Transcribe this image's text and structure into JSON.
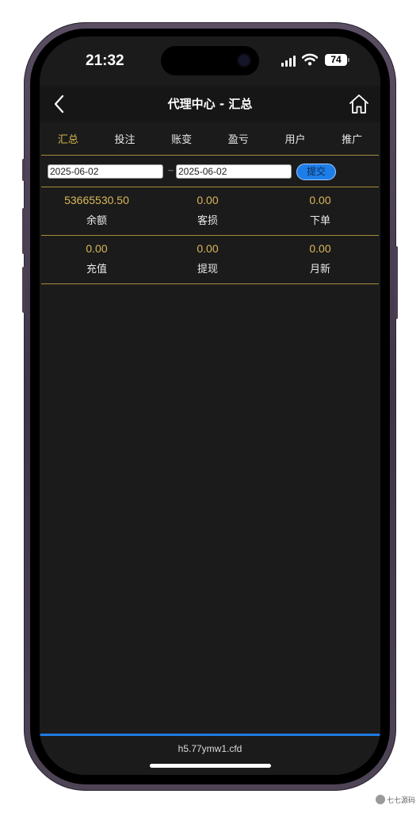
{
  "status_bar": {
    "time": "21:32",
    "battery": "74"
  },
  "header": {
    "title": "代理中心 - 汇总",
    "back_icon": "chevron-left-icon",
    "home_icon": "home-icon"
  },
  "tabs": [
    {
      "label": "汇总",
      "active": true
    },
    {
      "label": "投注",
      "active": false
    },
    {
      "label": "账变",
      "active": false
    },
    {
      "label": "盈亏",
      "active": false
    },
    {
      "label": "用户",
      "active": false
    },
    {
      "label": "推广",
      "active": false
    }
  ],
  "filter": {
    "start_date": "2025-06-02",
    "separator": "~",
    "end_date": "2025-06-02",
    "submit_label": "提交"
  },
  "stats": [
    [
      {
        "value": "53665530.50",
        "label": "余额"
      },
      {
        "value": "0.00",
        "label": "客损"
      },
      {
        "value": "0.00",
        "label": "下单"
      }
    ],
    [
      {
        "value": "0.00",
        "label": "充值"
      },
      {
        "value": "0.00",
        "label": "提现"
      },
      {
        "value": "0.00",
        "label": "月新"
      }
    ]
  ],
  "footer": {
    "domain": "h5.77ymw1.cfd"
  },
  "watermark": {
    "text": "七七源码"
  },
  "colors": {
    "accent_gold": "#d4b54e",
    "footer_blue": "#1f7be0",
    "background": "#1b1b1b"
  }
}
